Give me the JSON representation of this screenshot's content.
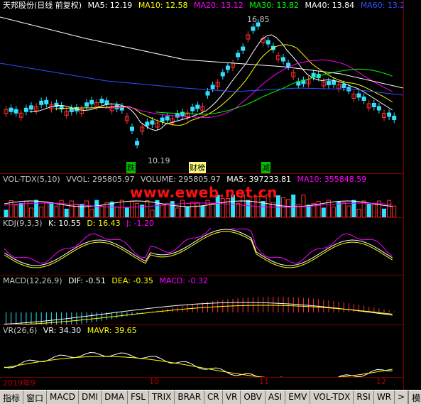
{
  "price_pane": {
    "stock": "天邦股份",
    "mode": "(日线 前复权)",
    "ma": [
      {
        "label": "MA5: 12.19",
        "color": "#ffffff"
      },
      {
        "label": "MA10: 12.58",
        "color": "#ffff00"
      },
      {
        "label": "MA20: 13.12",
        "color": "#ff00ff"
      },
      {
        "label": "MA30: 13.82",
        "color": "#00ff00"
      },
      {
        "label": "MA40: 13.84",
        "color": "#ffffff"
      },
      {
        "label": "MA60: 13.2",
        "color": "#3050ff"
      }
    ],
    "high_label": "16.85",
    "low_label": "10.19",
    "marks": [
      "跌",
      "财榜",
      "减"
    ]
  },
  "vol_pane": {
    "name": "VOL-TDX(5,10)",
    "items": [
      {
        "label": "VVOL: 295805.97",
        "color": "#c8c8c8"
      },
      {
        "label": "VOLUME: 295805.97",
        "color": "#c8c8c8"
      },
      {
        "label": "MA5: 397233.81",
        "color": "#ffffff"
      },
      {
        "label": "MA10: 355848.59",
        "color": "#ff00ff"
      }
    ]
  },
  "watermark": "www.eweb.net.cn",
  "kdj_pane": {
    "name": "KDJ(9,3,3)",
    "items": [
      {
        "label": "K: 10.55",
        "color": "#ffffff"
      },
      {
        "label": "D: 16.43",
        "color": "#ffff00"
      },
      {
        "label": "J: -1.20",
        "color": "#ff00ff"
      }
    ]
  },
  "macd_pane": {
    "name": "MACD(12,26,9)",
    "items": [
      {
        "label": "DIF: -0.51",
        "color": "#ffffff"
      },
      {
        "label": "DEA: -0.35",
        "color": "#ffff00"
      },
      {
        "label": "MACD: -0.32",
        "color": "#ff00ff"
      }
    ]
  },
  "vr_pane": {
    "name": "VR(26,6)",
    "items": [
      {
        "label": "VR: 34.30",
        "color": "#ffffff"
      },
      {
        "label": "MAVR: 39.65",
        "color": "#ffff00"
      }
    ]
  },
  "x_axis": [
    "2019年9",
    "10",
    "11",
    "12"
  ],
  "tabs": [
    "指标",
    "窗口",
    "MACD",
    "DMI",
    "DMA",
    "FSL",
    "TRIX",
    "BRAR",
    "CR",
    "VR",
    "OBV",
    "ASI",
    "EMV",
    "VOL-TDX",
    "RSI",
    "WR",
    ">"
  ],
  "right_tab": "模板",
  "colors": {
    "up": "#ff3030",
    "down": "#30e0ff",
    "axis": "#7a0000"
  }
}
